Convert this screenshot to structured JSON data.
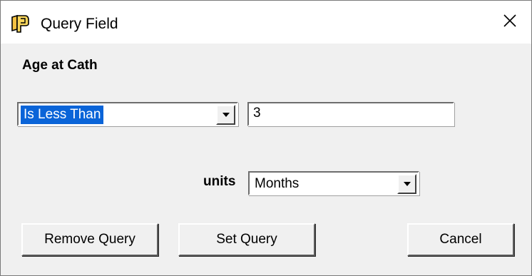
{
  "window": {
    "title": "Query Field",
    "close_symbol": "✕"
  },
  "icons": {
    "app": "book-icon",
    "close": "close-icon",
    "dropdown": "chevron-down-icon"
  },
  "field": {
    "name": "Age at Cath",
    "operator": "Is Less Than",
    "value": "3"
  },
  "units": {
    "label": "units",
    "selected": "Months"
  },
  "buttons": {
    "remove": "Remove Query",
    "set": "Set Query",
    "cancel": "Cancel"
  },
  "colors": {
    "selection": "#0a64d8",
    "face": "#f0f0f0"
  }
}
